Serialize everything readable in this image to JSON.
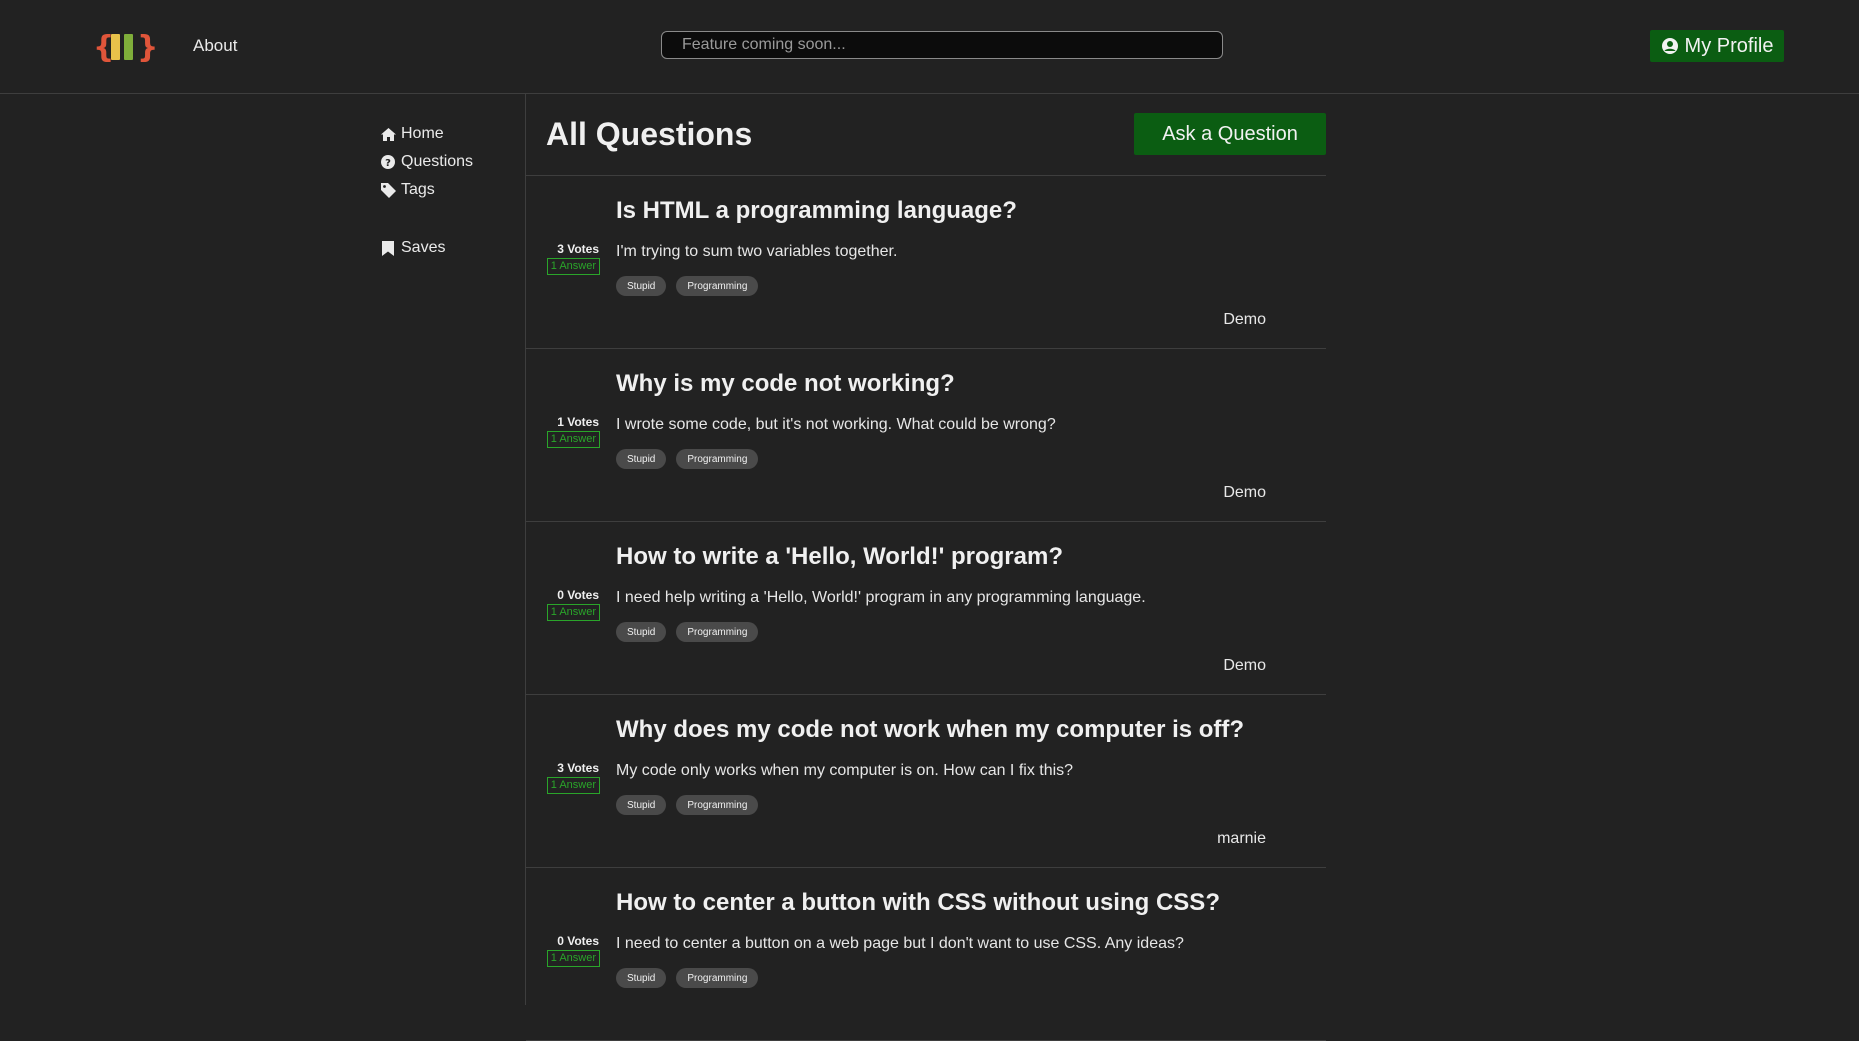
{
  "header": {
    "about_label": "About",
    "search_placeholder": "Feature coming soon...",
    "profile_label": "My Profile"
  },
  "sidebar": {
    "items": [
      {
        "label": "Home",
        "icon": "home-icon"
      },
      {
        "label": "Questions",
        "icon": "question-circle-icon"
      },
      {
        "label": "Tags",
        "icon": "tag-icon"
      }
    ],
    "saves_label": "Saves"
  },
  "main": {
    "title": "All Questions",
    "ask_label": "Ask a Question"
  },
  "questions": [
    {
      "title": "Is HTML a programming language?",
      "body": "I'm trying to sum two variables together.",
      "votes": "3 Votes",
      "answers": "1 Answer",
      "tags": [
        "Stupid",
        "Programming"
      ],
      "author": "Demo"
    },
    {
      "title": "Why is my code not working?",
      "body": "I wrote some code, but it's not working. What could be wrong?",
      "votes": "1 Votes",
      "answers": "1 Answer",
      "tags": [
        "Stupid",
        "Programming"
      ],
      "author": "Demo"
    },
    {
      "title": "How to write a 'Hello, World!' program?",
      "body": "I need help writing a 'Hello, World!' program in any programming language.",
      "votes": "0 Votes",
      "answers": "1 Answer",
      "tags": [
        "Stupid",
        "Programming"
      ],
      "author": "Demo"
    },
    {
      "title": "Why does my code not work when my computer is off?",
      "body": "My code only works when my computer is on. How can I fix this?",
      "votes": "3 Votes",
      "answers": "1 Answer",
      "tags": [
        "Stupid",
        "Programming"
      ],
      "author": "marnie"
    },
    {
      "title": "How to center a button with CSS without using CSS?",
      "body": "I need to center a button on a web page but I don't want to use CSS. Any ideas?",
      "votes": "0 Votes",
      "answers": "1 Answer",
      "tags": [
        "Stupid",
        "Programming"
      ],
      "author": ""
    }
  ],
  "colors": {
    "background": "#222222",
    "accent_green": "#0b5d12",
    "answer_green": "#2aa52a",
    "tag_bg": "#4a4a4a"
  }
}
